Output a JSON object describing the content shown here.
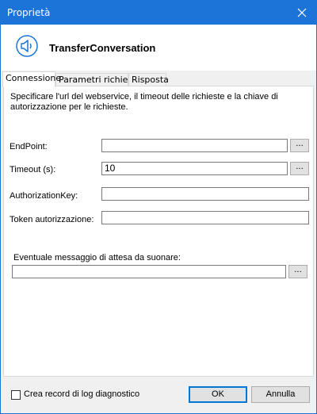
{
  "window": {
    "title": "Proprietà"
  },
  "header": {
    "title": "TransferConversation",
    "icon": "speaker-icon"
  },
  "tabs": [
    {
      "label": "Connessione",
      "active": true
    },
    {
      "label": "Parametri richiesta",
      "active": false
    },
    {
      "label": "Risposta",
      "active": false
    }
  ],
  "description": "Specificare l'url del webservice, il timeout delle richieste e la chiave di autorizzazione per le richieste.",
  "form": {
    "endpoint": {
      "label": "EndPoint:",
      "value": ""
    },
    "timeout": {
      "label": "Timeout (s):",
      "value": "10"
    },
    "authorization_key": {
      "label": "AuthorizationKey:",
      "value": ""
    },
    "token": {
      "label": "Token autorizzazione:",
      "value": ""
    },
    "wait_message": {
      "label": "Eventuale messaggio di attesa da suonare:",
      "value": ""
    },
    "browse_label": "..."
  },
  "footer": {
    "log_checkbox_label": "Crea record di log diagnostico",
    "log_checked": false,
    "ok_label": "OK",
    "cancel_label": "Annulla"
  }
}
